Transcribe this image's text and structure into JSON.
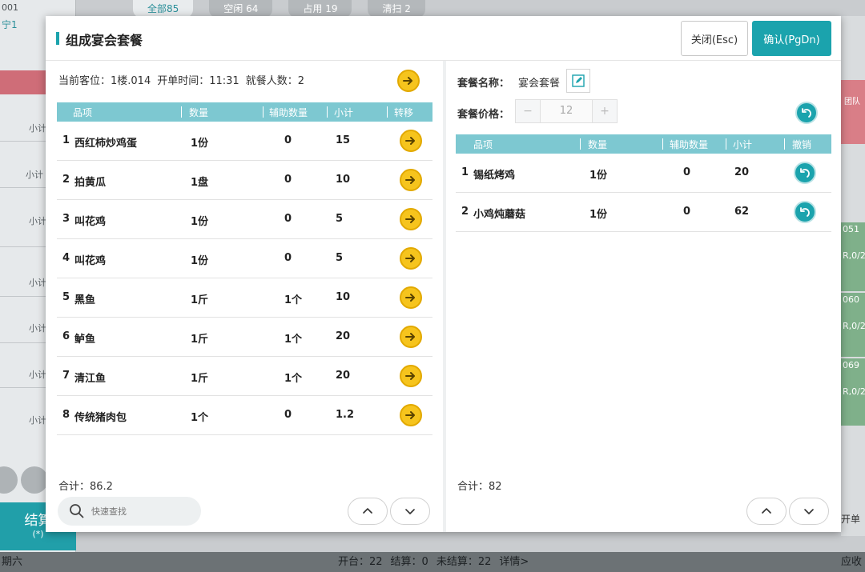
{
  "background": {
    "top_id": "001",
    "top_small": "宁1",
    "tabs": [
      {
        "label": "全部85"
      },
      {
        "label": "空闲 64"
      },
      {
        "label": "占用 19"
      },
      {
        "label": "清扫 2"
      }
    ],
    "subtotal_label": "小计",
    "settle_label": "结算",
    "settle_hint": "(*)",
    "right_tags": [
      "团队",
      "051",
      "R,0/2",
      "060",
      "R,0/2",
      "069",
      "R,0/2"
    ],
    "open_label": "开单",
    "status": {
      "day": "期六",
      "open": "开台：22",
      "settled": "结算：0",
      "unsettled": "未结算：22",
      "detail": "详情>",
      "receivable": "应收"
    }
  },
  "modal": {
    "title": "组成宴会套餐",
    "close_label": "关闭(Esc)",
    "confirm_label": "确认(PgDn)"
  },
  "left": {
    "seat": "当前客位：1楼.014",
    "open_time": "开单时间：11:31",
    "guests": "就餐人数：2",
    "columns": [
      "品项",
      "数量",
      "辅助数量",
      "小计",
      "转移"
    ],
    "rows": [
      {
        "no": "1",
        "name": "西红柿炒鸡蛋",
        "qty": "1份",
        "aux": "0",
        "subtotal": "15"
      },
      {
        "no": "2",
        "name": "拍黄瓜",
        "qty": "1盘",
        "aux": "0",
        "subtotal": "10"
      },
      {
        "no": "3",
        "name": "叫花鸡",
        "qty": "1份",
        "aux": "0",
        "subtotal": "5"
      },
      {
        "no": "4",
        "name": "叫花鸡",
        "qty": "1份",
        "aux": "0",
        "subtotal": "5"
      },
      {
        "no": "5",
        "name": "黑鱼",
        "qty": "1斤",
        "aux": "1个",
        "subtotal": "10"
      },
      {
        "no": "6",
        "name": "鲈鱼",
        "qty": "1斤",
        "aux": "1个",
        "subtotal": "20"
      },
      {
        "no": "7",
        "name": "清江鱼",
        "qty": "1斤",
        "aux": "1个",
        "subtotal": "20"
      },
      {
        "no": "8",
        "name": "传统猪肉包",
        "qty": "1个",
        "aux": "0",
        "subtotal": "1.2"
      }
    ],
    "total": "合计：86.2",
    "search_placeholder": "快速查找"
  },
  "right": {
    "name_label": "套餐名称：",
    "name_value": "宴会套餐",
    "price_label": "套餐价格：",
    "price_minus": "−",
    "price_value": "12",
    "price_plus": "+",
    "columns": [
      "品项",
      "数量",
      "辅助数量",
      "小计",
      "撤销"
    ],
    "rows": [
      {
        "no": "1",
        "name": "锡纸烤鸡",
        "qty": "1份",
        "aux": "0",
        "subtotal": "20"
      },
      {
        "no": "2",
        "name": "小鸡炖蘑菇",
        "qty": "1份",
        "aux": "0",
        "subtotal": "62"
      }
    ],
    "total": "合计：82"
  },
  "colors": {
    "accent": "#1ba3ad",
    "header": "#7dc8d1",
    "transfer": "#f6c41d"
  }
}
